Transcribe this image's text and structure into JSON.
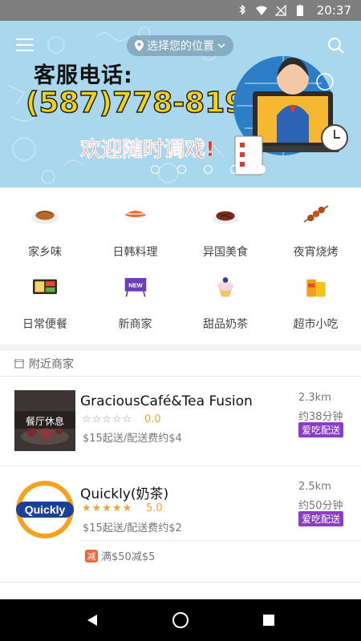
{
  "status_bar": {
    "time": "20:37"
  },
  "header": {
    "location_label": "选择您的位置"
  },
  "banner": {
    "line1": "客服电话:",
    "phone": "(587)778-8198",
    "line3": "欢迎随时调戏!",
    "slide_count": 5,
    "active_slide": 5
  },
  "categories": [
    {
      "label": "家乡味",
      "icon": "noodle-dish-icon"
    },
    {
      "label": "日韩料理",
      "icon": "sushi-icon"
    },
    {
      "label": "异国美食",
      "icon": "steak-icon"
    },
    {
      "label": "夜宵烧烤",
      "icon": "skewer-icon"
    },
    {
      "label": "日常便餐",
      "icon": "bento-icon"
    },
    {
      "label": "新商家",
      "icon": "new-sign-icon"
    },
    {
      "label": "甜品奶茶",
      "icon": "cupcake-icon"
    },
    {
      "label": "超市小吃",
      "icon": "snacks-icon"
    }
  ],
  "nearby": {
    "title": "附近商家"
  },
  "merchants": [
    {
      "name": "GraciousCafé&Tea Fusion",
      "closed_overlay": "餐厅休息",
      "stars_filled": 0,
      "rating": "0.0",
      "fees": "$15起送/配送费约$4",
      "distance": "2.3km",
      "eta": "约38分钟",
      "delivery_badge": "爱吃配送"
    },
    {
      "name": "Quickly(奶茶)",
      "logo_text": "Quickly",
      "stars_filled": 5,
      "rating": "5.0",
      "fees": "$15起送/配送费约$2",
      "distance": "2.5km",
      "eta": "约50分钟",
      "delivery_badge": "爱吃配送",
      "promo_tag": "减",
      "promo_text": "满$50减$5"
    }
  ],
  "colors": {
    "banner_bg": "#a9d7ee",
    "badge": "#8a3ec8",
    "rating": "#f0a43a",
    "promo": "#f0643c"
  }
}
